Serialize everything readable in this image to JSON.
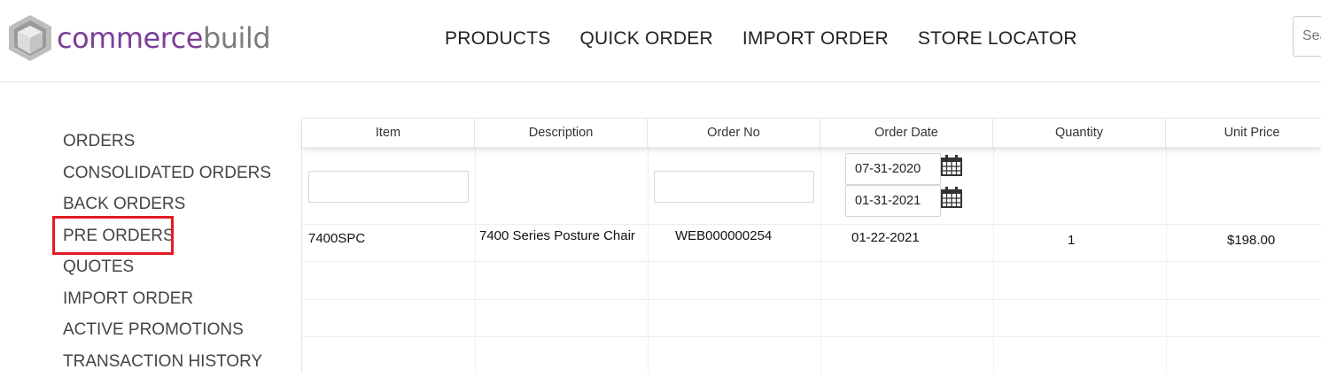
{
  "brand": {
    "name_part1": "commerce",
    "name_part2": "build",
    "color_primary": "#7b3f98",
    "color_secondary": "#7c7c7c"
  },
  "nav": {
    "products": "PRODUCTS",
    "quick_order": "QUICK ORDER",
    "import_order": "IMPORT ORDER",
    "store_locator": "STORE LOCATOR"
  },
  "search": {
    "placeholder": "Search"
  },
  "sidebar": {
    "items": [
      {
        "label": "ORDERS"
      },
      {
        "label": "CONSOLIDATED ORDERS"
      },
      {
        "label": "BACK ORDERS"
      },
      {
        "label": "PRE ORDERS",
        "highlighted": true
      },
      {
        "label": "QUOTES"
      },
      {
        "label": "IMPORT ORDER"
      },
      {
        "label": "ACTIVE PROMOTIONS"
      },
      {
        "label": "TRANSACTION HISTORY"
      }
    ],
    "highlight_color": "#e31b23"
  },
  "table": {
    "columns": [
      "Item",
      "Description",
      "Order No",
      "Order Date",
      "Quantity",
      "Unit Price"
    ],
    "filters": {
      "item": "",
      "order_no": "",
      "date_from": "07-31-2020",
      "date_to": "01-31-2021"
    },
    "rows": [
      {
        "item": "7400SPC",
        "description": "7400 Series Posture Chair",
        "order_no": "WEB000000254",
        "order_date": "01-22-2021",
        "quantity": "1",
        "unit_price": "$198.00"
      }
    ]
  },
  "icons": {
    "calendar": "calendar-icon",
    "logo": "cube-logo-icon"
  }
}
